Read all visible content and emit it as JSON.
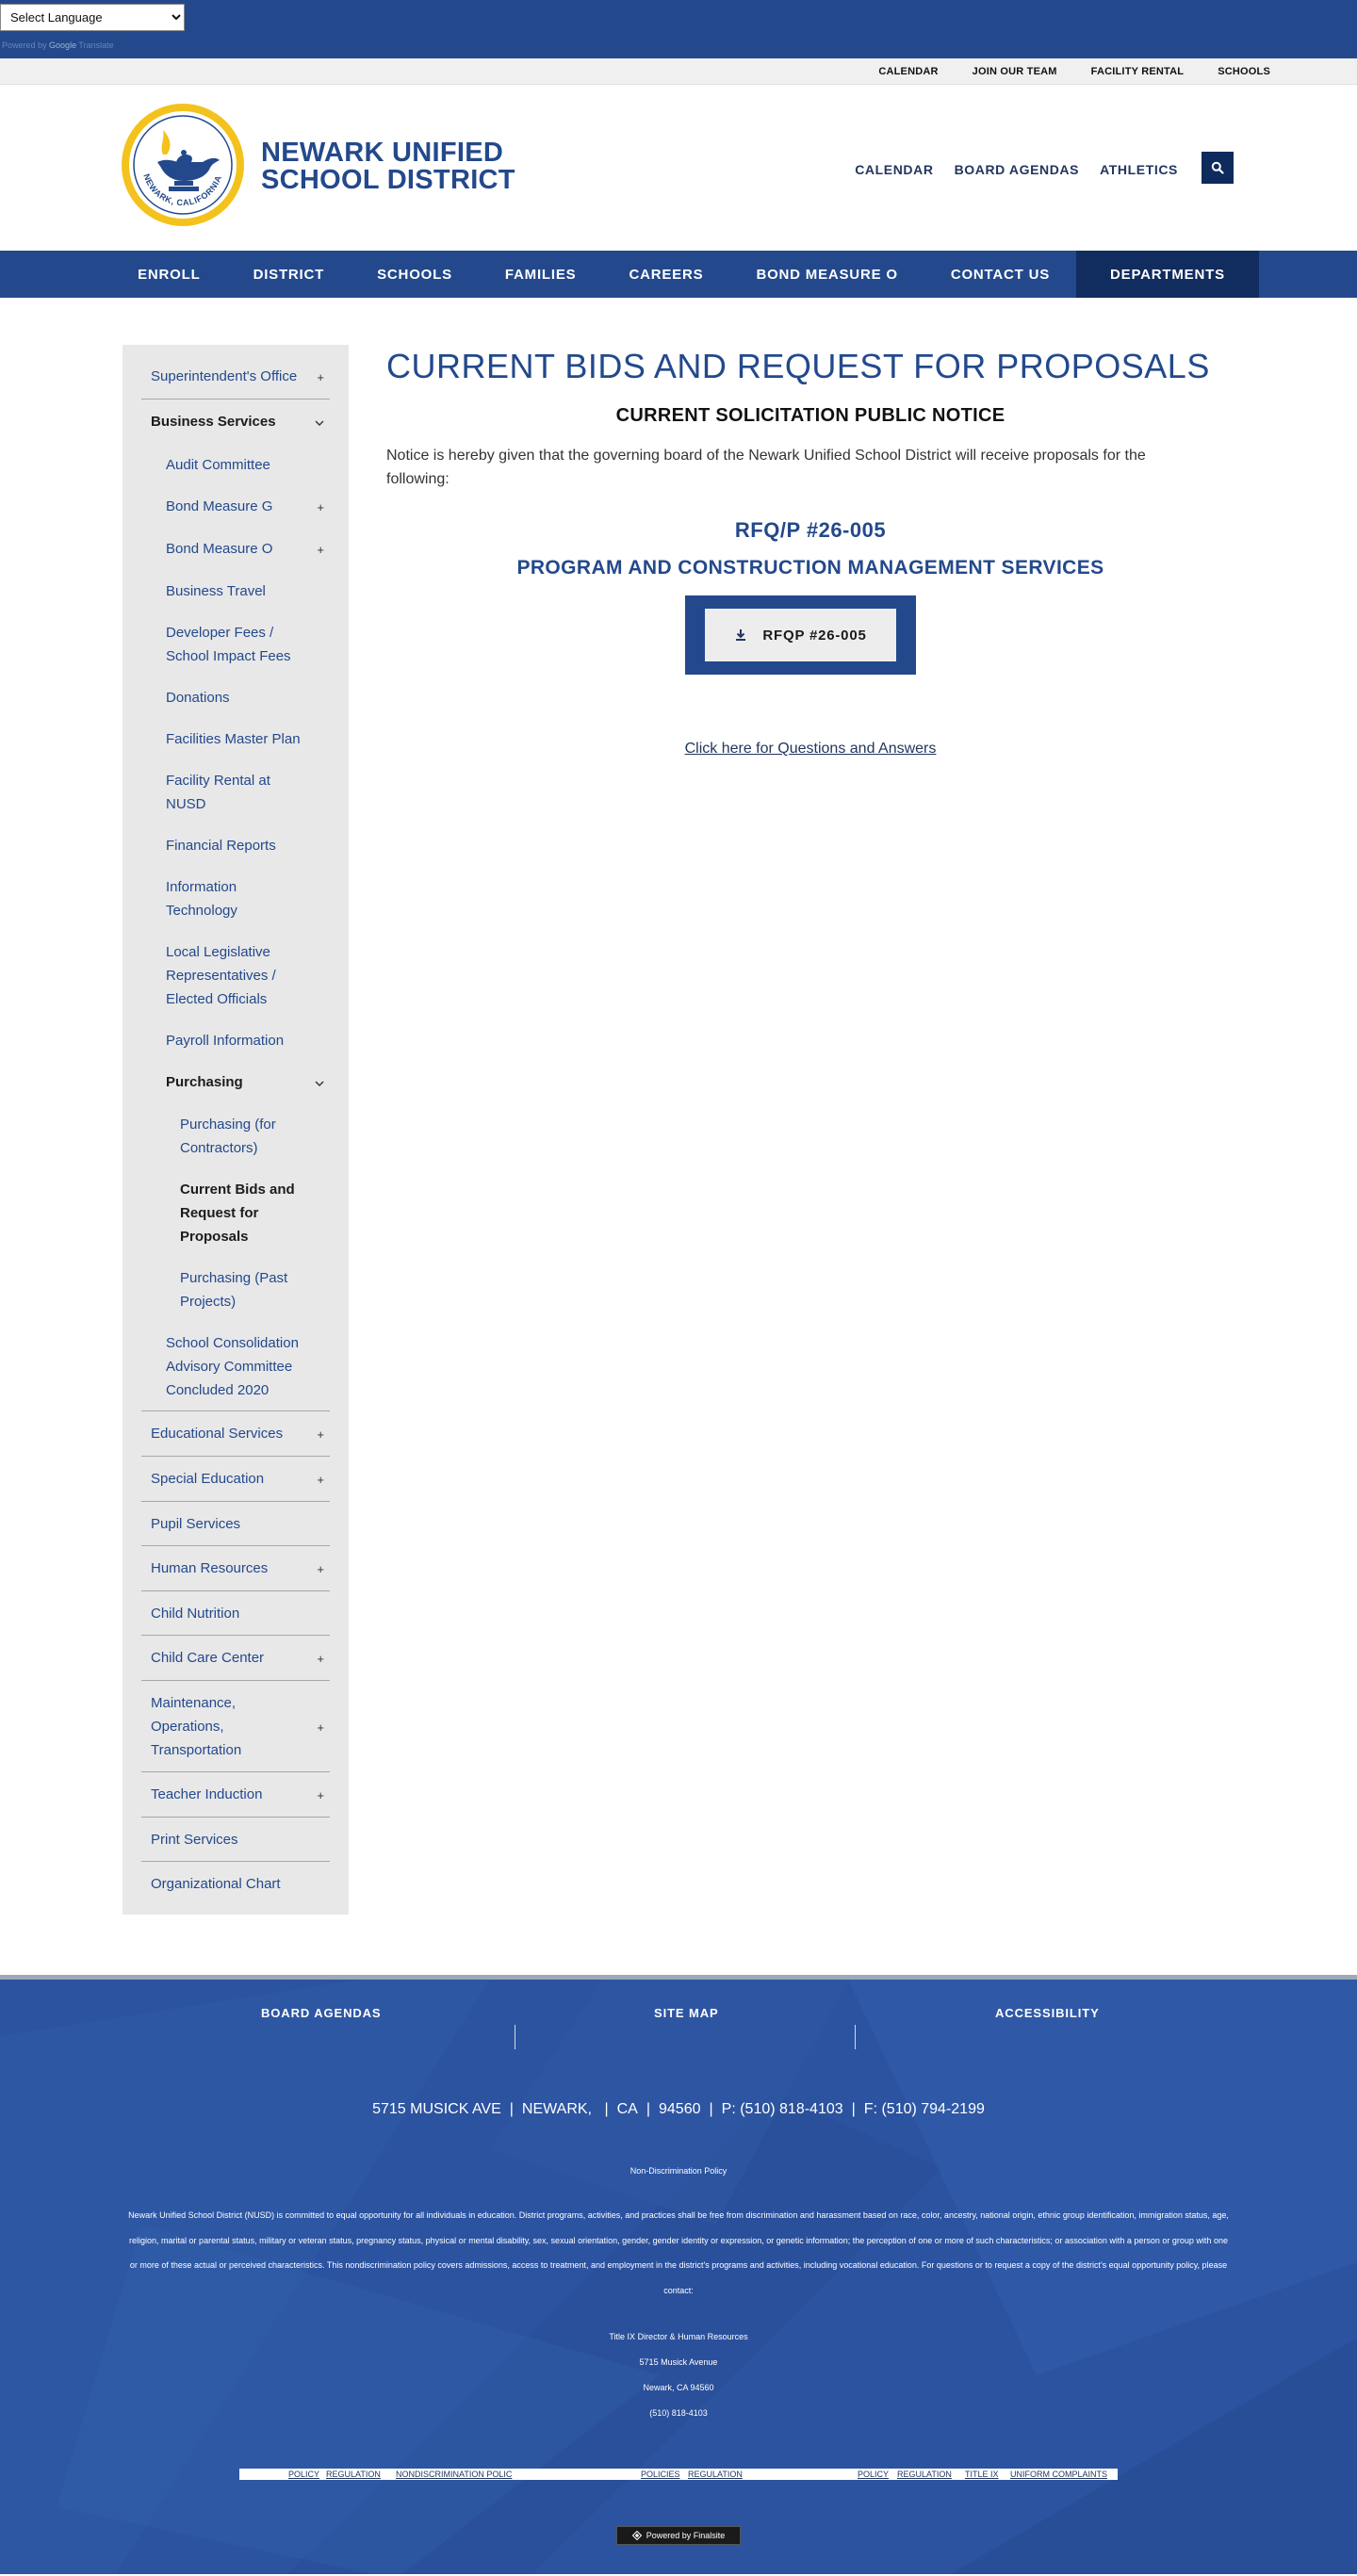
{
  "language": {
    "select_value": "Select Language",
    "powered_by": "Powered by",
    "powered_brand": "Google",
    "powered_service": "Translate"
  },
  "utility_nav": [
    "CALENDAR",
    "JOIN OUR TEAM",
    "FACILITY RENTAL",
    "SCHOOLS"
  ],
  "header": {
    "district_line1": "NEWARK UNIFIED",
    "district_line2": "SCHOOL DISTRICT",
    "logo_text": "NEWARK, CALIFORNIA",
    "links": [
      "CALENDAR",
      "BOARD AGENDAS",
      "ATHLETICS"
    ],
    "search_icon": "search-icon"
  },
  "main_nav": [
    "ENROLL",
    "DISTRICT",
    "SCHOOLS",
    "FAMILIES",
    "CAREERS",
    "BOND MEASURE O",
    "CONTACT US",
    "DEPARTMENTS"
  ],
  "main_nav_active": "DEPARTMENTS",
  "sidebar": {
    "superintendent": "Superintendent's Office",
    "business": "Business Services",
    "business_children": {
      "audit": "Audit Committee",
      "bond_g": "Bond Measure G",
      "bond_o": "Bond Measure O",
      "travel": "Business Travel",
      "developer": "Developer Fees / School Impact Fees",
      "donations": "Donations",
      "facilities": "Facilities Master Plan",
      "rental": "Facility Rental at NUSD",
      "financial": "Financial Reports",
      "it": "Information Technology",
      "legislative": "Local Legislative Representatives / Elected Officials",
      "payroll": "Payroll Information",
      "purchasing": "Purchasing",
      "purchasing_children": {
        "contractors": "Purchasing (for Contractors)",
        "current": "Current Bids and Request for Proposals",
        "past": "Purchasing (Past Projects)"
      },
      "consolidation": "School Consolidation Advisory Committee Concluded 2020"
    },
    "educational": "Educational Services",
    "special_ed": "Special Education",
    "pupil": "Pupil Services",
    "hr": "Human Resources",
    "nutrition": "Child Nutrition",
    "child_care": "Child Care Center",
    "maintenance": "Maintenance, Operations, Transportation",
    "teacher": "Teacher Induction",
    "print": "Print Services",
    "org_chart": "Organizational Chart",
    "plus": "+",
    "chevron": "⌄"
  },
  "main": {
    "title": "CURRENT BIDS AND REQUEST FOR PROPOSALS",
    "notice_heading": "CURRENT SOLICITATION PUBLIC NOTICE",
    "notice_text": "Notice is hereby given that the governing board of the Newark Unified School District will receive proposals for the following:",
    "rfq_number": "RFQ/P #26-005",
    "rfq_title": "PROGRAM AND CONSTRUCTION MANAGEMENT SERVICES",
    "download_label": "RFQP #26-005",
    "qa_link": "Click here for Questions and Answers"
  },
  "footer": {
    "links": [
      "BOARD AGENDAS",
      "SITE MAP",
      "ACCESSIBILITY"
    ],
    "address": {
      "street": "5715 MUSICK AVE",
      "city": "NEWARK,",
      "state": "CA",
      "zip": "94560",
      "phone": "P: (510) 818-4103",
      "fax": "F: (510) 794-2199"
    },
    "ndp_title": "Non-Discrimination Policy",
    "ndp_body": "Newark Unified School District (NUSD) is committed to equal opportunity for all individuals in education. District programs, activities, and practices shall be free from discrimination and harassment based on race, color, ancestry, national origin, ethnic group identification, immigration status, age, religion, marital or parental status, military or veteran status, pregnancy status, physical or mental disability, sex, sexual orientation, gender, gender identity or expression, or genetic information; the perception of one or more of such characteristics; or association with a person or group with one or more of these actual or perceived characteristics. This nondiscrimination policy covers admissions, access to treatment, and employment in the district's programs and activities, including vocational education. For questions or to request a copy of the district's equal opportunity policy, please contact:",
    "contact": [
      "Title IX Director & Human Resources",
      "5715 Musick Avenue",
      "Newark, CA 94560",
      "(510) 818-4103"
    ],
    "policy_links": [
      "POLICY",
      "REGULATION",
      "NONDISCRIMINATION POLIC",
      "POLICIES",
      "REGULATION",
      "POLICY",
      "REGULATION",
      "TITLE IX",
      "UNIFORM COMPLAINTS"
    ],
    "finalsite": "Powered by Finalsite"
  }
}
